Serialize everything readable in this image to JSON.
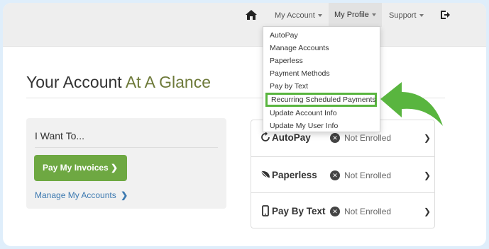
{
  "navbar": {
    "items": [
      {
        "label": "My Account"
      },
      {
        "label": "My Profile"
      },
      {
        "label": "Support"
      }
    ]
  },
  "dropdown": {
    "items": [
      {
        "label": "AutoPay"
      },
      {
        "label": "Manage Accounts"
      },
      {
        "label": "Paperless"
      },
      {
        "label": "Payment Methods"
      },
      {
        "label": "Pay by Text"
      },
      {
        "label": "Recurring Scheduled Payments"
      },
      {
        "label": "Update Account Info"
      },
      {
        "label": "Update My User Info"
      }
    ]
  },
  "page": {
    "title_main": "Your Account",
    "title_accent": "At A Glance"
  },
  "want": {
    "title": "I Want To...",
    "pay_button": "Pay My Invoices",
    "manage_link": "Manage My Accounts"
  },
  "status": {
    "rows": [
      {
        "label": "AutoPay",
        "status": "Not Enrolled"
      },
      {
        "label": "Paperless",
        "status": "Not Enrolled"
      },
      {
        "label": "Pay By Text",
        "status": "Not Enrolled"
      }
    ]
  },
  "colors": {
    "accent_green": "#6ea842",
    "highlight_green": "#59b53f",
    "link_blue": "#3c79b0",
    "title_accent": "#6e7a3a"
  },
  "icons": {
    "home": "home-icon",
    "logout": "logout-icon",
    "autopay": "refresh-icon",
    "paperless": "leaf-icon",
    "pay_by_text": "phone-icon",
    "status": "x-circle-icon"
  }
}
